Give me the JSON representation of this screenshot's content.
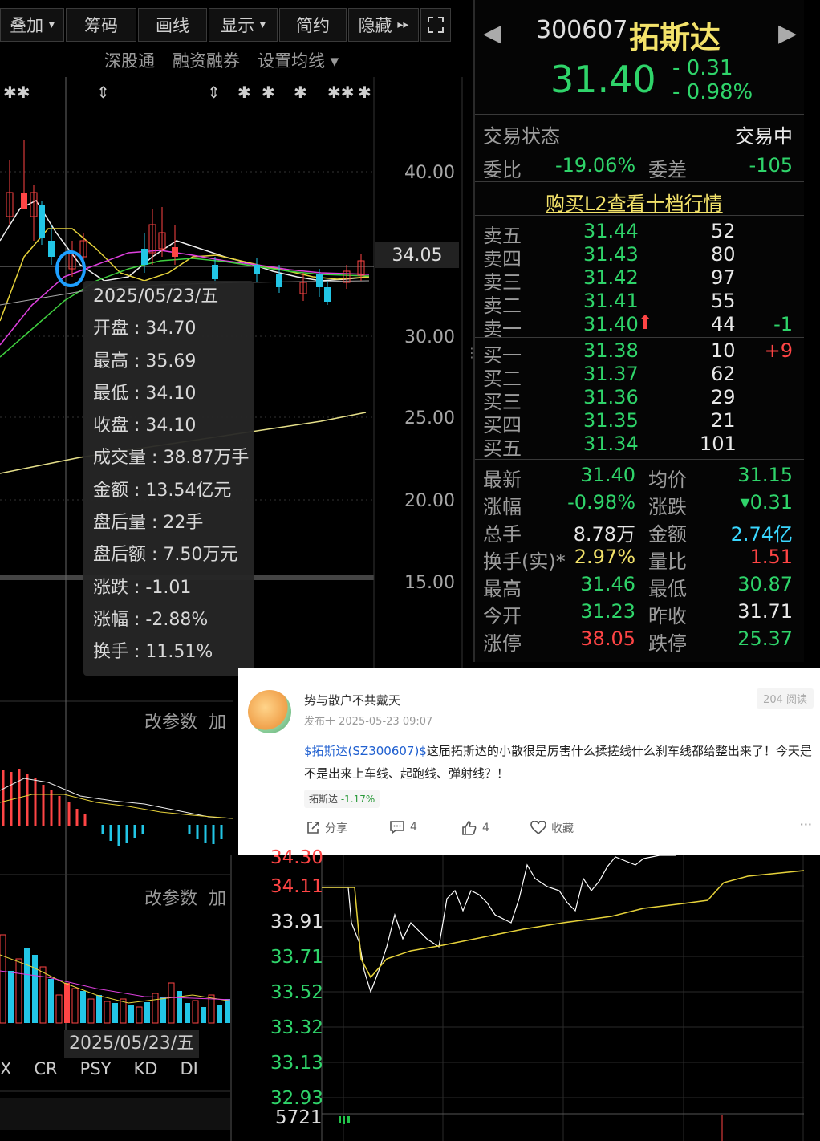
{
  "toolbar": {
    "buttons": [
      "叠加",
      "筹码",
      "画线",
      "显示",
      "简约",
      "隐藏"
    ],
    "dropdown_markers": [
      "▾",
      "▾"
    ],
    "expand_icon": "expand-icon"
  },
  "sub_links": [
    "深股通",
    "融资融券",
    "设置均线 ▾"
  ],
  "kline": {
    "price_axis": [
      "40.00",
      "30.00",
      "25.00",
      "20.00",
      "15.00"
    ],
    "cursor_price": "34.05",
    "markers": [
      "✱✱",
      "⇕",
      "⇕",
      "✱",
      "✱",
      "✱",
      "✱✱",
      "✱"
    ]
  },
  "tooltip": {
    "date": "2025/05/23/五",
    "lines": [
      "开盘 : 34.70",
      "最高 : 35.69",
      "最低 : 34.10",
      "收盘 : 34.10",
      "成交量 : 38.87万手",
      "金额 : 13.54亿元",
      "盘后量 : 22手",
      "盘后额 : 7.50万元",
      "涨跌 : -1.01",
      "涨幅 : -2.88%",
      "换手 : 11.51%"
    ]
  },
  "indicator_panels": {
    "param_label": "改参数",
    "add_label": "加",
    "bottom_date": "2025/05/23/五",
    "tabs": [
      "X",
      "CR",
      "PSY",
      "KD",
      "DI"
    ]
  },
  "quote": {
    "code": "300607",
    "name": "拓斯达",
    "price": "31.40",
    "change": "- 0.31",
    "pct": "- 0.98%",
    "status_label": "交易状态",
    "status_value": "交易中",
    "ratio_label": "委比",
    "ratio_value": "-19.06%",
    "diff_label": "委差",
    "diff_value": "-105",
    "l2_link": "购买L2查看十档行情",
    "asks": [
      {
        "label": "卖五",
        "price": "31.44",
        "vol": "52",
        "chg": ""
      },
      {
        "label": "卖四",
        "price": "31.43",
        "vol": "80",
        "chg": ""
      },
      {
        "label": "卖三",
        "price": "31.42",
        "vol": "97",
        "chg": ""
      },
      {
        "label": "卖二",
        "price": "31.41",
        "vol": "55",
        "chg": ""
      },
      {
        "label": "卖一",
        "price": "31.40",
        "vol": "44",
        "chg": "-1"
      }
    ],
    "bids": [
      {
        "label": "买一",
        "price": "31.38",
        "vol": "10",
        "chg": "+9"
      },
      {
        "label": "买二",
        "price": "31.37",
        "vol": "62",
        "chg": ""
      },
      {
        "label": "买三",
        "price": "31.36",
        "vol": "29",
        "chg": ""
      },
      {
        "label": "买四",
        "price": "31.35",
        "vol": "21",
        "chg": ""
      },
      {
        "label": "买五",
        "price": "31.34",
        "vol": "101",
        "chg": ""
      }
    ],
    "stats": [
      {
        "l1": "最新",
        "v1": "31.40",
        "c1": "green",
        "l2": "均价",
        "v2": "31.15",
        "c2": "green"
      },
      {
        "l1": "涨幅",
        "v1": "-0.98%",
        "c1": "green",
        "l2": "涨跌",
        "v2": "▾0.31",
        "c2": "green"
      },
      {
        "l1": "总手",
        "v1": "8.78万",
        "c1": "white",
        "l2": "金额",
        "v2": "2.74亿",
        "c2": "cyan"
      },
      {
        "l1": "换手(实)*",
        "v1": "2.97%",
        "c1": "yellow",
        "l2": "量比",
        "v2": "1.51",
        "c2": "red"
      },
      {
        "l1": "最高",
        "v1": "31.46",
        "c1": "green",
        "l2": "最低",
        "v2": "30.87",
        "c2": "green"
      },
      {
        "l1": "今开",
        "v1": "31.23",
        "c1": "green",
        "l2": "昨收",
        "v2": "31.71",
        "c2": "white"
      },
      {
        "l1": "涨停",
        "v1": "38.05",
        "c1": "red",
        "l2": "跌停",
        "v2": "25.37",
        "c2": "green"
      }
    ]
  },
  "post": {
    "author": "势与散户不共戴天",
    "time": "发布于 2025-05-23 09:07",
    "reads": "204 阅读",
    "tag": "$拓斯达(SZ300607)$",
    "text1": "这届拓斯达的小散很是厉害什么揉搓线什么刹车线都给整出来了！今天是",
    "text2": "不是出来上车线、起跑线、弹射线？！",
    "stock_chip_name": "拓斯达",
    "stock_chip_pct": "-1.17%",
    "share": "分享",
    "comments": "4",
    "likes": "4",
    "fav": "收藏",
    "more": "···"
  },
  "intraday": {
    "price_levels": [
      {
        "v": "34.11",
        "color": "#ff4545"
      },
      {
        "v": "33.91",
        "color": "#e0e0e0"
      },
      {
        "v": "33.71",
        "color": "#2fd46a"
      },
      {
        "v": "33.52",
        "color": "#2fd46a"
      },
      {
        "v": "33.32",
        "color": "#2fd46a"
      },
      {
        "v": "33.13",
        "color": "#2fd46a"
      },
      {
        "v": "32.93",
        "color": "#2fd46a"
      }
    ],
    "volume_label": "5721"
  }
}
